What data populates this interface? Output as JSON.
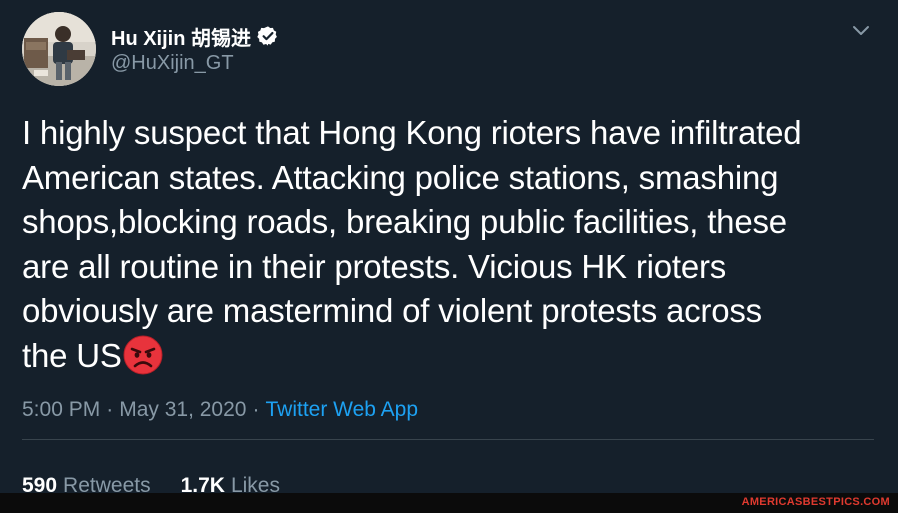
{
  "tweet": {
    "author": {
      "display_name": "Hu Xijin 胡锡进",
      "handle": "@HuXijin_GT",
      "verified": true,
      "avatar_icon": "avatar-photo"
    },
    "text_lines": [
      "I highly suspect that Hong Kong rioters have infiltrated",
      "American states. Attacking police stations, smashing",
      "shops,blocking roads, breaking public facilities, these",
      "are all routine in their protests. Vicious HK rioters",
      "obviously are mastermind of violent protests across",
      "the US"
    ],
    "emoji": "angry-face-emoji",
    "time": "5:00 PM",
    "separator": "·",
    "date": "May 31, 2020",
    "source": "Twitter Web App",
    "retweets_count": "590",
    "retweets_label": "Retweets",
    "likes_count": "1.7K",
    "likes_label": "Likes"
  },
  "watermark": "AMERICASBESTPICS.COM",
  "colors": {
    "background": "#15202b",
    "text_primary": "#ffffff",
    "text_secondary": "#8899a6",
    "link": "#1da1f2",
    "divider": "#38444d",
    "verified_badge": "#ffffff",
    "emoji_face": "#e8333c",
    "watermark": "#e03a2f"
  }
}
